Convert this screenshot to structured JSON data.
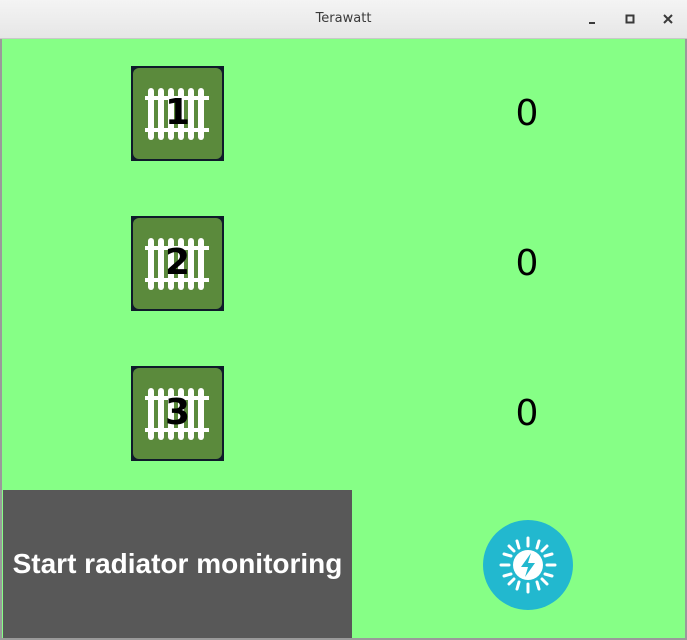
{
  "window": {
    "title": "Terawatt"
  },
  "radiators": [
    {
      "label": "1",
      "value": "0"
    },
    {
      "label": "2",
      "value": "0"
    },
    {
      "label": "3",
      "value": "0"
    }
  ],
  "start_button_label": "Start radiator monitoring",
  "icons": {
    "radiator": "radiator-icon",
    "power": "solar-power-icon",
    "minimize": "minimize-icon",
    "maximize": "maximize-icon",
    "close": "close-icon"
  },
  "colors": {
    "background": "#86ff86",
    "radiator_button": "#5b8a3c",
    "start_button": "#585858",
    "power_button": "#22b8cf"
  }
}
